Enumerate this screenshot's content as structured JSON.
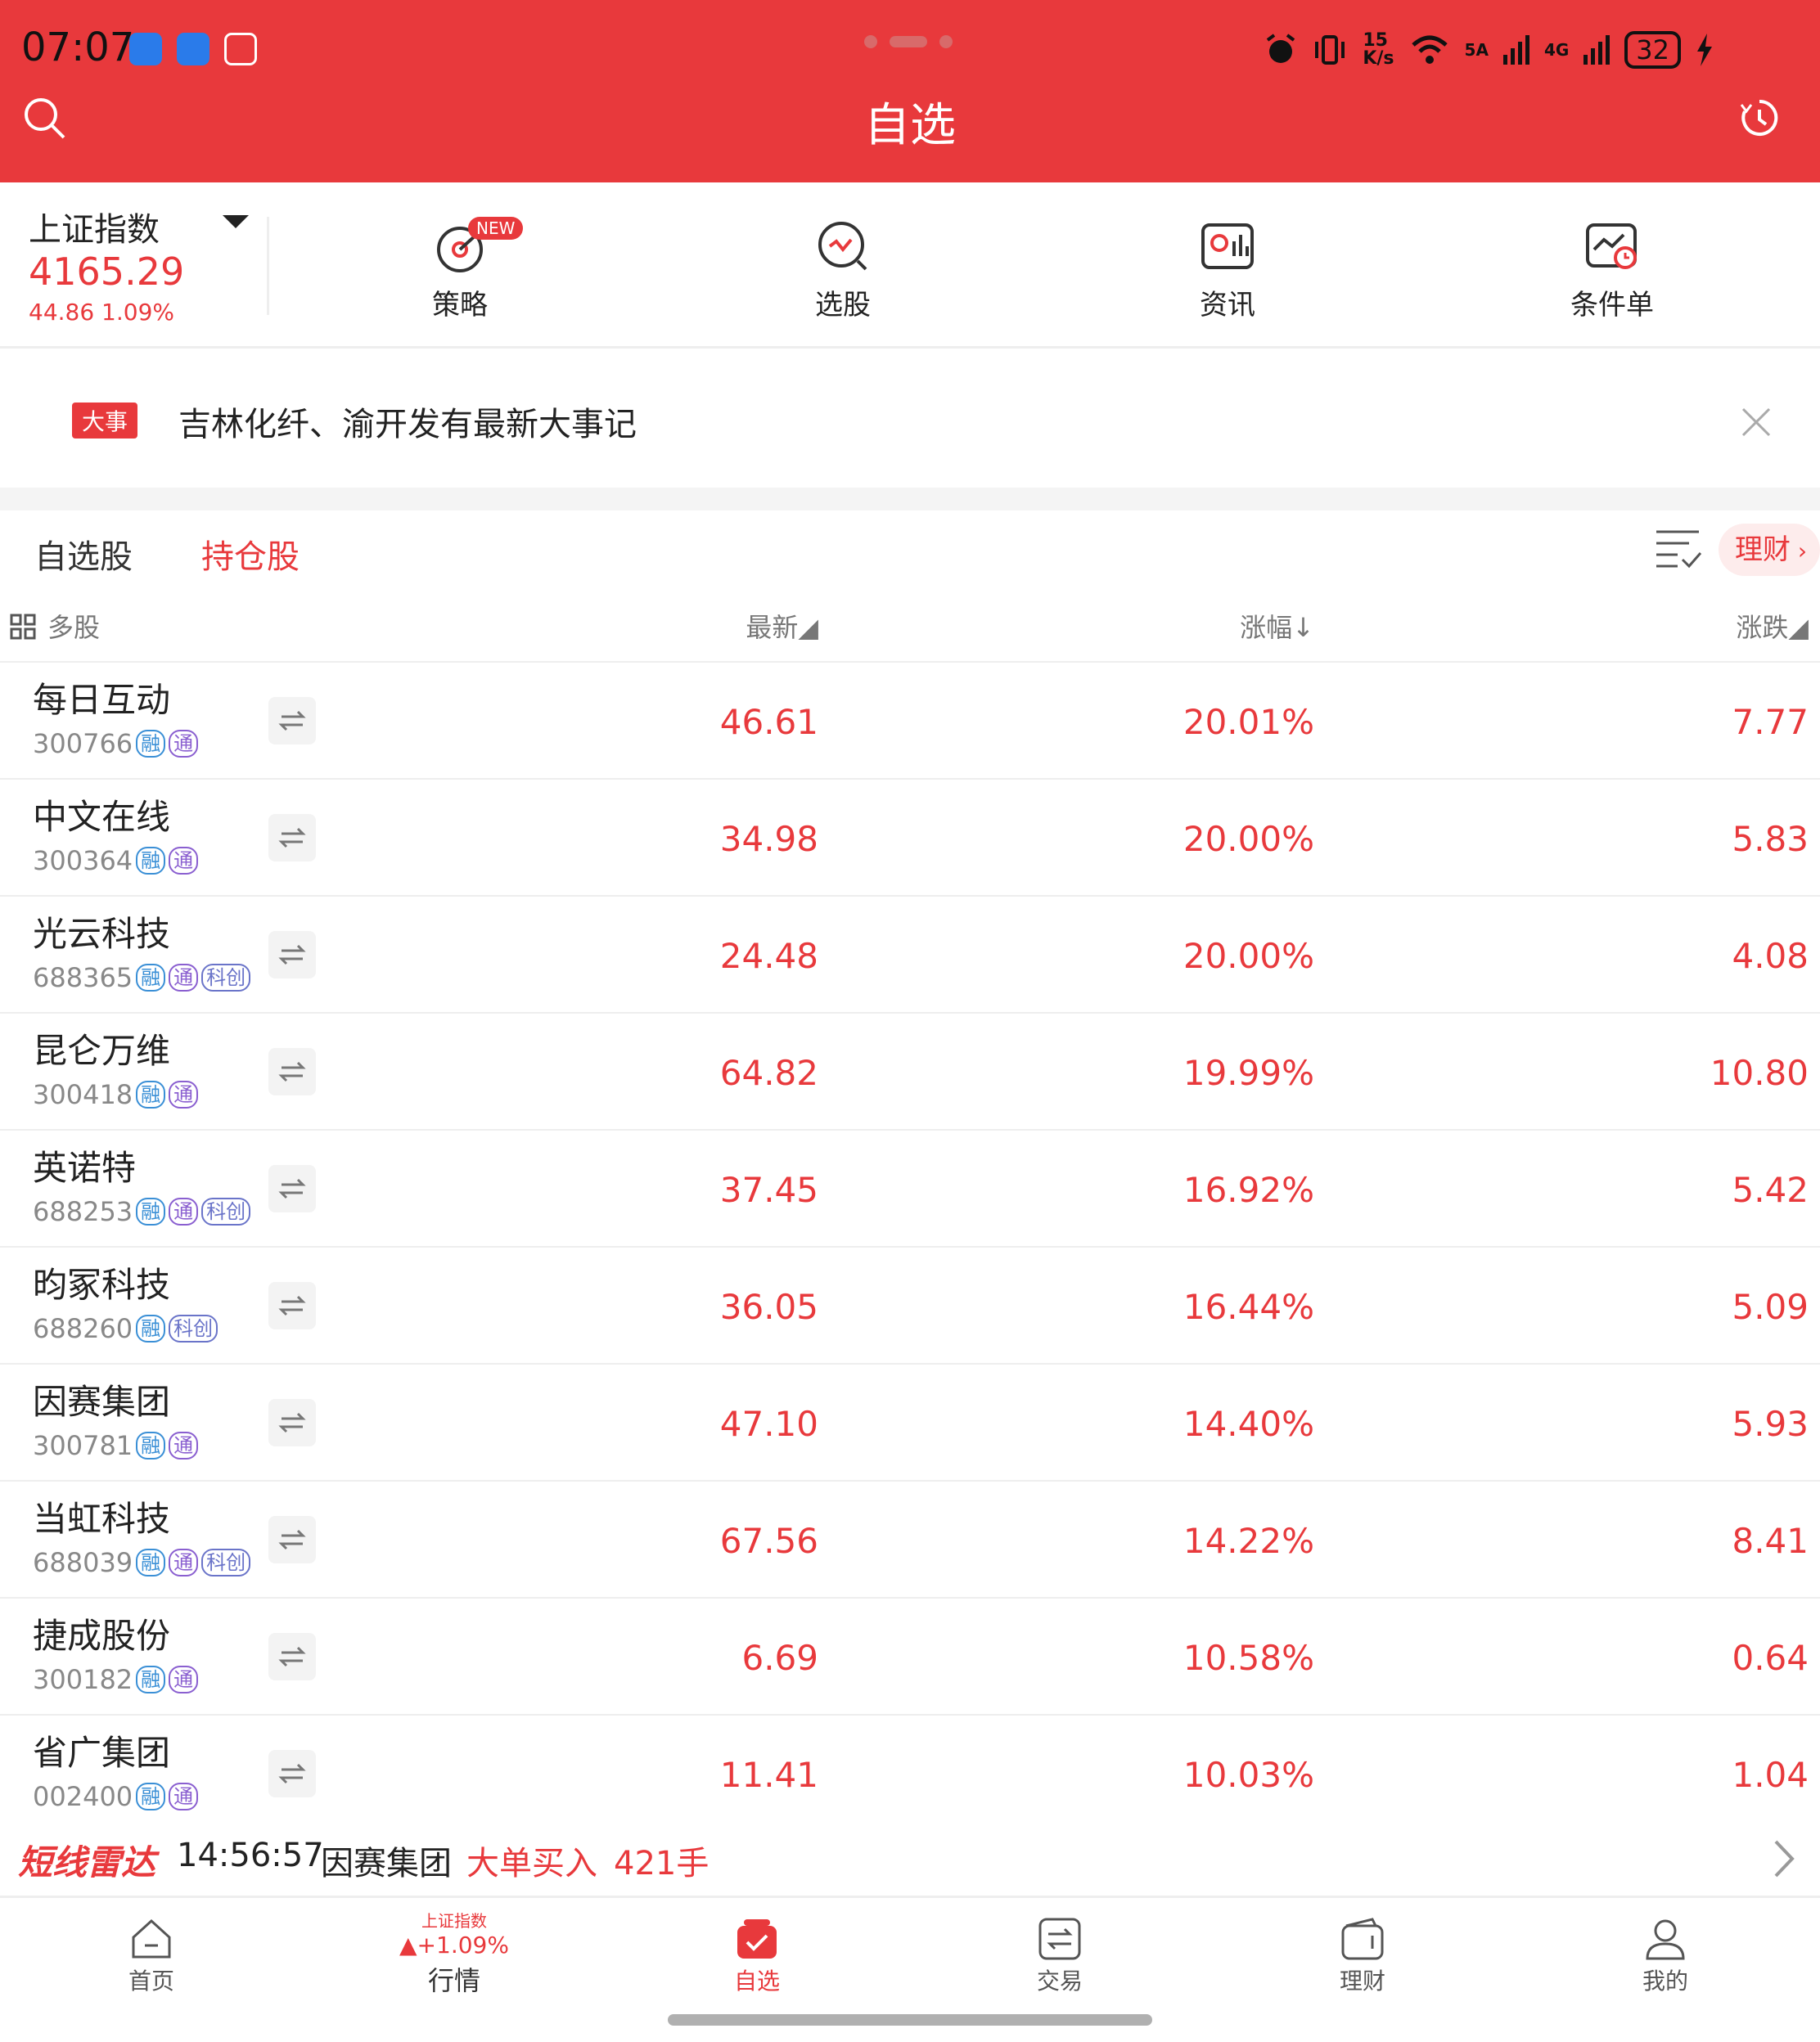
{
  "status_bar": {
    "time": "07:07",
    "net_speed_top": "15",
    "net_speed_bottom": "K/s",
    "signal_5a": "5A",
    "signal_4g": "4G",
    "battery": "32"
  },
  "header": {
    "title": "自选"
  },
  "index": {
    "name": "上证指数",
    "value": "4165.29",
    "change": "44.86  1.09%"
  },
  "nav": [
    {
      "label": "策略",
      "badge": "NEW"
    },
    {
      "label": "选股"
    },
    {
      "label": "资讯"
    },
    {
      "label": "条件单"
    }
  ],
  "notice": {
    "badge": "大事",
    "text": "吉林化纤、渝开发有最新大事记"
  },
  "tabs": {
    "watch": "自选股",
    "holdings": "持仓股",
    "licai": "理财"
  },
  "columns": {
    "multi": "多股",
    "latest": "最新◢",
    "pct": "涨幅↓",
    "chg": "涨跌◢"
  },
  "stocks": [
    {
      "name": "每日互动",
      "code": "300766",
      "tags": [
        "融",
        "通"
      ],
      "price": "46.61",
      "pct": "20.01%",
      "chg": "7.77"
    },
    {
      "name": "中文在线",
      "code": "300364",
      "tags": [
        "融",
        "通"
      ],
      "price": "34.98",
      "pct": "20.00%",
      "chg": "5.83"
    },
    {
      "name": "光云科技",
      "code": "688365",
      "tags": [
        "融",
        "通",
        "科创"
      ],
      "price": "24.48",
      "pct": "20.00%",
      "chg": "4.08"
    },
    {
      "name": "昆仑万维",
      "code": "300418",
      "tags": [
        "融",
        "通"
      ],
      "price": "64.82",
      "pct": "19.99%",
      "chg": "10.80"
    },
    {
      "name": "英诺特",
      "code": "688253",
      "tags": [
        "融",
        "通",
        "科创"
      ],
      "price": "37.45",
      "pct": "16.92%",
      "chg": "5.42"
    },
    {
      "name": "昀冢科技",
      "code": "688260",
      "tags": [
        "融",
        "科创"
      ],
      "price": "36.05",
      "pct": "16.44%",
      "chg": "5.09"
    },
    {
      "name": "因赛集团",
      "code": "300781",
      "tags": [
        "融",
        "通"
      ],
      "price": "47.10",
      "pct": "14.40%",
      "chg": "5.93"
    },
    {
      "name": "当虹科技",
      "code": "688039",
      "tags": [
        "融",
        "通",
        "科创"
      ],
      "price": "67.56",
      "pct": "14.22%",
      "chg": "8.41"
    },
    {
      "name": "捷成股份",
      "code": "300182",
      "tags": [
        "融",
        "通"
      ],
      "price": "6.69",
      "pct": "10.58%",
      "chg": "0.64"
    },
    {
      "name": "省广集团",
      "code": "002400",
      "tags": [
        "融",
        "通"
      ],
      "price": "11.41",
      "pct": "10.03%",
      "chg": "1.04"
    }
  ],
  "ticker": {
    "brand": "短线雷达",
    "time": "14:56:57",
    "stock": "因赛集团",
    "action": "大单买入",
    "volume": "421手"
  },
  "bottom_nav": {
    "home": "首页",
    "market_index_name": "上证指数",
    "market_index_change": "▲+1.09%",
    "market": "行情",
    "watch": "自选",
    "trade": "交易",
    "licai": "理财",
    "mine": "我的"
  },
  "colors": {
    "accent": "#e8393c",
    "tag_rong": "#3a8fd6",
    "tag_tong": "#8a5fd0"
  }
}
